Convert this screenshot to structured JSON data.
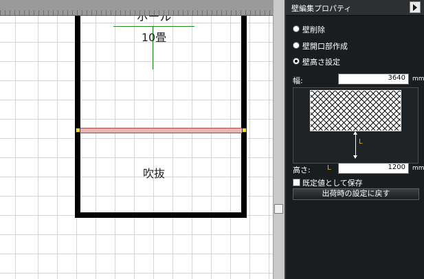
{
  "canvas": {
    "room_name": "ホール",
    "room_size": "10畳",
    "atrium_label": "吹抜"
  },
  "panel": {
    "title": "壁編集プロパティ",
    "options": [
      {
        "label": "壁削除",
        "selected": false
      },
      {
        "label": "壁開口部作成",
        "selected": false
      },
      {
        "label": "壁高さ設定",
        "selected": true
      }
    ],
    "width_label": "幅:",
    "width_value": "3640",
    "width_unit": "mm",
    "preview_label": "L",
    "height_label": "高さ:",
    "height_var": "L",
    "height_value": "1200",
    "height_unit": "mm",
    "save_default_label": "既定値として保存",
    "reset_button": "出荷時の設定に戻す"
  },
  "colors": {
    "panel_bg": "#1a1d1f",
    "selected_wall": "#e8b4b4",
    "handle": "#ffe300",
    "accent_l": "#f5b400",
    "room_line": "#1f8a1f"
  }
}
